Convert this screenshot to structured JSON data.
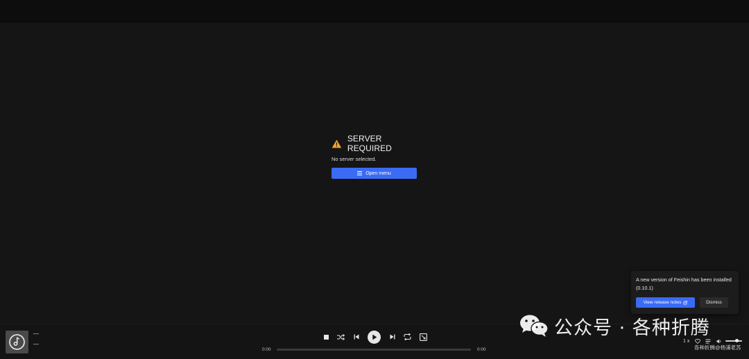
{
  "main": {
    "title": "SERVER REQUIRED",
    "subtitle": "No server selected.",
    "open_menu_label": "Open menu"
  },
  "toast": {
    "message": "A new version of Feishin has been installed (0.10.1)",
    "view_release_notes_label": "View release notes",
    "dismiss_label": "Dismiss"
  },
  "player": {
    "track_title": "—",
    "track_artist": "—",
    "time_elapsed": "0:00",
    "time_total": "0:00",
    "speed": "1 x",
    "progress": 0,
    "volume": 0.8
  },
  "watermark": {
    "text": "公众号 · 各种折腾",
    "subtext": "各种折腾@杨浦老苏"
  },
  "colors": {
    "accent": "#3b6bf5",
    "warning": "#f5a623",
    "background": "#151515"
  },
  "icons": [
    "warning-icon",
    "menu-icon",
    "external-link-icon",
    "album-art-placeholder-icon",
    "stop-icon",
    "shuffle-icon",
    "previous-icon",
    "play-icon",
    "next-icon",
    "repeat-icon",
    "queue-icon",
    "heart-icon",
    "lyrics-icon",
    "volume-icon",
    "wechat-icon"
  ]
}
